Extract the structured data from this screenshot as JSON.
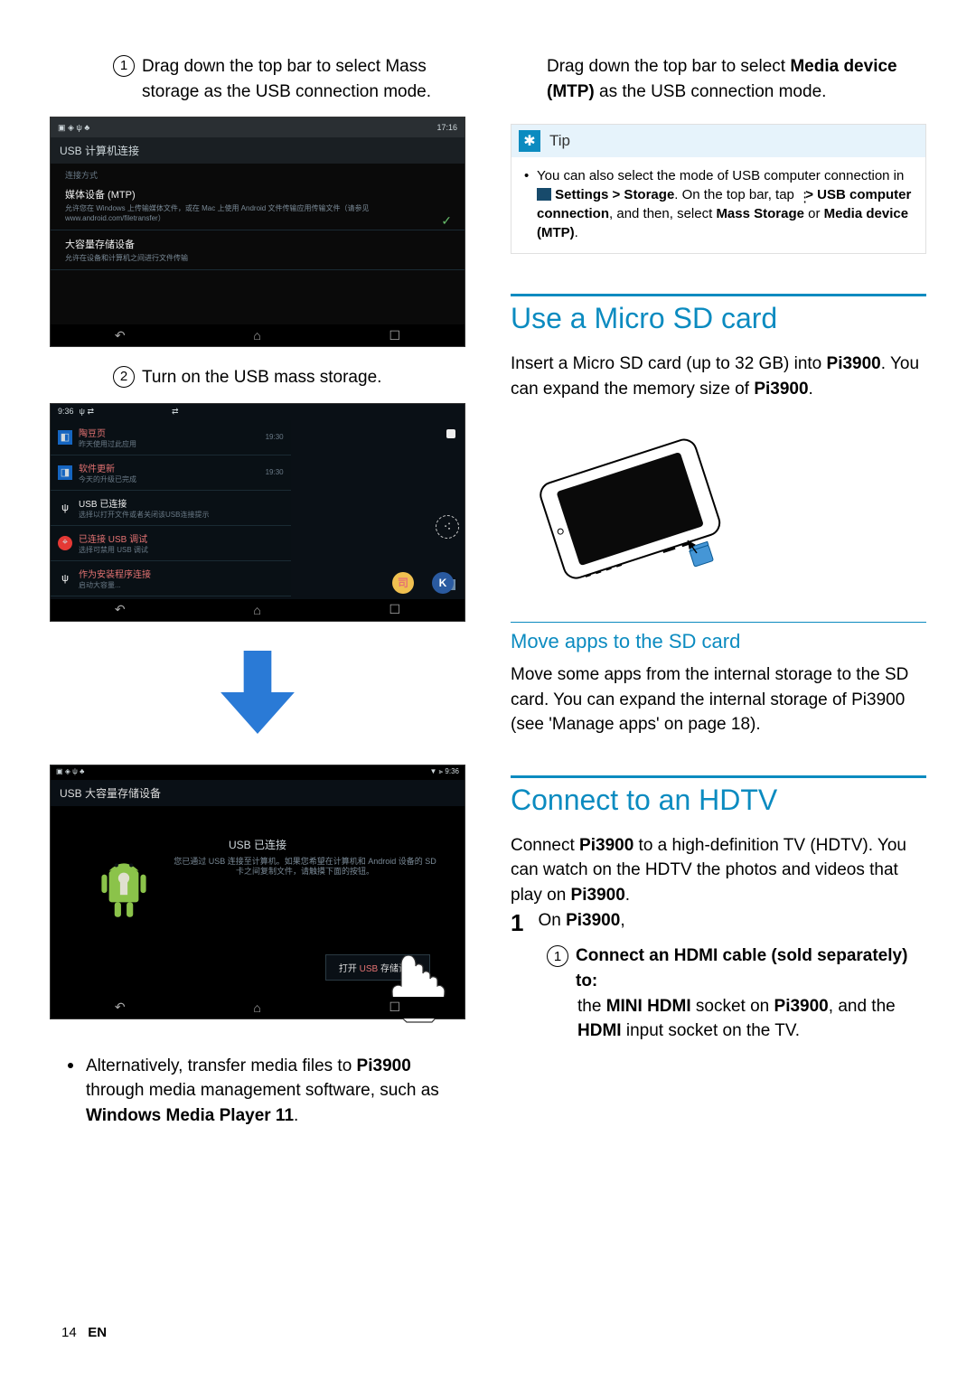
{
  "left": {
    "step1": {
      "num": "1",
      "text_a": "Drag down the top bar to select ",
      "text_b": "Mass storage",
      "text_c": " as the USB connection mode."
    },
    "shot1": {
      "status_left": "",
      "status_right": "17:16",
      "title": "USB 计算机连接",
      "cat": "连接方式",
      "row1_title": "媒体设备 (MTP)",
      "row1_sub": "允许您在 Windows 上传输媒体文件，或在 Mac 上使用 Android 文件传输应用传输文件（请参见 www.android.com/filetransfer）",
      "row2_title": "大容量存储设备",
      "row2_sub": "允许在设备和计算机之间进行文件传输"
    },
    "step2": {
      "num": "2",
      "text": "Turn on the USB mass storage."
    },
    "shot2": {
      "time": "9:36",
      "n1_t": "陶豆页",
      "n1_s": "昨天使用过此应用",
      "n1_time": "19:30",
      "n2_t": "软件更新",
      "n2_s": "今天的升级已完成",
      "n2_time": "19:30",
      "n3_t": "USB 已连接",
      "n3_s": "选择以打开文件或者关闭该USB连接提示",
      "n4_t": "已连接 USB 调试",
      "n4_s": "选择可禁用 USB 调试",
      "n5_t": "作为安装程序连接",
      "n5_s": "启动大容量..."
    },
    "shot3": {
      "status_right": "9:36",
      "title": "USB 大容量存储设备",
      "connected": "USB 已连接",
      "sub": "您已通过 USB 连接至计算机。如果您希望在计算机和 Android 设备的 SD 卡之间复制文件，请触摸下面的按钮。",
      "btn_a": "打开 ",
      "btn_b": "USB ",
      "btn_c": "存储设备"
    },
    "alt": {
      "a": "Alternatively, transfer media files to ",
      "b": "Pi3900",
      "c": " through media management software, such as ",
      "d": "Windows Media Player 11",
      "e": "."
    }
  },
  "right": {
    "intro": {
      "a": "Drag down the top bar to select ",
      "b": "Media device (MTP)",
      "c": " as the USB connection mode."
    },
    "tip": {
      "title": "Tip",
      "a": "You can also select the mode of USB computer connection in ",
      "b": " Settings > Storage",
      "c": ". On the top bar, tap ",
      "d": " > USB computer connection",
      "e": ", and then, select ",
      "f": "Mass Storage",
      "g": " or ",
      "h": "Media device (MTP)",
      "i": "."
    },
    "sd": {
      "title": "Use a Micro SD card",
      "a": "Insert a Micro SD card (up to 32 GB) into ",
      "b": "Pi3900",
      "c": ". You can expand the memory size of ",
      "d": "Pi3900",
      "e": "."
    },
    "move": {
      "title": "Move apps to the SD card",
      "a": "Move some apps from the internal storage to the SD card. You can expand the internal storage of Pi3900 (see 'Manage apps' on page 18)."
    },
    "hdtv": {
      "title": "Connect to an HDTV",
      "a": "Connect ",
      "b": "Pi3900",
      "c": " to a high-definition TV (HDTV). You can watch on the HDTV the photos and videos that play on ",
      "d": "Pi3900",
      "e": ".",
      "step1_num": "1",
      "step1_a": "On ",
      "step1_b": "Pi3900",
      "step1_c": ",",
      "sub_num": "1",
      "sub_a": "Connect an HDMI cable (sold separately) to:",
      "line_a": "the ",
      "line_b": "MINI HDMI",
      "line_c": " socket on ",
      "line_d": "Pi3900",
      "line_e": ", and the ",
      "line_f": "HDMI",
      "line_g": " input socket on the TV."
    }
  },
  "footer": {
    "page": "14",
    "lang": "EN"
  }
}
